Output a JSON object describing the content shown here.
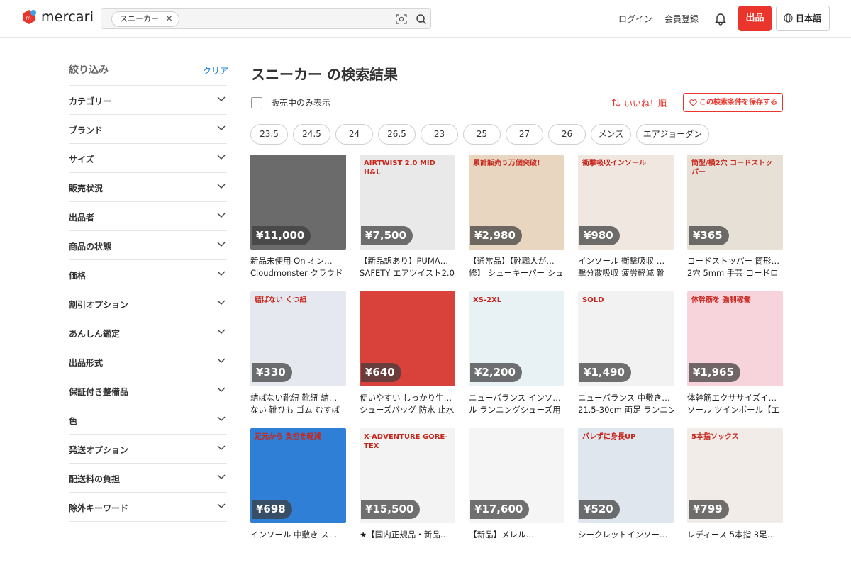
{
  "header": {
    "logo_text": "mercari",
    "search_chip": "スニーカー",
    "login": "ログイン",
    "register": "会員登録",
    "sell": "出品",
    "language": "日本語"
  },
  "sidebar": {
    "title": "絞り込み",
    "clear": "クリア",
    "items": [
      "カテゴリー",
      "ブランド",
      "サイズ",
      "販売状況",
      "出品者",
      "商品の状態",
      "価格",
      "割引オプション",
      "あんしん鑑定",
      "出品形式",
      "保証付き整備品",
      "色",
      "発送オプション",
      "配送料の負担",
      "除外キーワード"
    ]
  },
  "main": {
    "title": "スニーカー の検索結果",
    "on_sale_only": "販売中のみ表示",
    "sort": "いいね！順",
    "save_search": "この検索条件を保存する",
    "tags": [
      "23.5",
      "24.5",
      "24",
      "26.5",
      "23",
      "25",
      "27",
      "26",
      "メンズ",
      "エアジョーダン"
    ]
  },
  "products": [
    {
      "price": "¥11,000",
      "name1": "新品未使用 On オン…",
      "name2": "Cloudmonster クラウド",
      "bg": "#6b6b6b",
      "overlay": ""
    },
    {
      "price": "¥7,500",
      "name1": "【新品訳あり】PUMA…",
      "name2": "SAFETY エアツイスト2.0",
      "bg": "#e9e9e9",
      "overlay": "AIRTWIST 2.0 MID H&L"
    },
    {
      "price": "¥2,980",
      "name1": "【通常品】【靴職人が…",
      "name2": "修】 シューキーパー シュ",
      "bg": "#e8d6c0",
      "overlay": "累計販売５万個突破！"
    },
    {
      "price": "¥980",
      "name1": "インソール 衝撃吸収 …",
      "name2": "撃分散吸収 疲労軽減 靴",
      "bg": "#f0e8e0",
      "overlay": "衝撃吸収インソール"
    },
    {
      "price": "¥365",
      "name1": "コードストッパー 筒形…",
      "name2": "2穴 5mm 手芸 コードロ",
      "bg": "#e6e0d6",
      "overlay": "筒型/横2穴 コードストッパー"
    },
    {
      "price": "¥330",
      "name1": "結ばない靴紐 靴紐 結…",
      "name2": "ない 靴ひも ゴム むすば",
      "bg": "#e5e9ef",
      "overlay": "結ばない くつ紐"
    },
    {
      "price": "¥640",
      "name1": "使いやすい しっかり生…",
      "name2": "シューズバッグ 防水 止水",
      "bg": "#d9423a",
      "overlay": ""
    },
    {
      "price": "¥2,200",
      "name1": "ニューバランス インソ…",
      "name2": "ル ランニングシューズ用",
      "bg": "#e8f1f3",
      "overlay": "XS-2XL"
    },
    {
      "price": "¥1,490",
      "name1": "ニューバランス 中敷き…",
      "name2": "21.5-30cm 両足 ランニン",
      "bg": "#f2f2f2",
      "overlay": "SOLD"
    },
    {
      "price": "¥1,965",
      "name1": "体幹筋エクササイズイ…",
      "name2": "ソール ツインボール【エ",
      "bg": "#f7d3dc",
      "overlay": "体幹筋を 強制稼働"
    },
    {
      "price": "¥698",
      "name1": "インソール 中敷き ス…",
      "name2": "",
      "bg": "#2f7fd6",
      "overlay": "足元から 負担を軽減"
    },
    {
      "price": "¥15,500",
      "name1": "★【国内正規品・新品…",
      "name2": "",
      "bg": "#f3f3f3",
      "overlay": "X-ADVENTURE GORE-TEX"
    },
    {
      "price": "¥17,600",
      "name1": "【新品】メレル…",
      "name2": "",
      "bg": "#f5f5f5",
      "overlay": ""
    },
    {
      "price": "¥520",
      "name1": "シークレットインソー…",
      "name2": "",
      "bg": "#dfe6ee",
      "overlay": "バレずに身長UP"
    },
    {
      "price": "¥799",
      "name1": "レディース 5本指 3足…",
      "name2": "",
      "bg": "#f1ece8",
      "overlay": "5本指ソックス"
    }
  ],
  "colors": {
    "accent": "#ea352d",
    "link": "#0c78ce"
  }
}
